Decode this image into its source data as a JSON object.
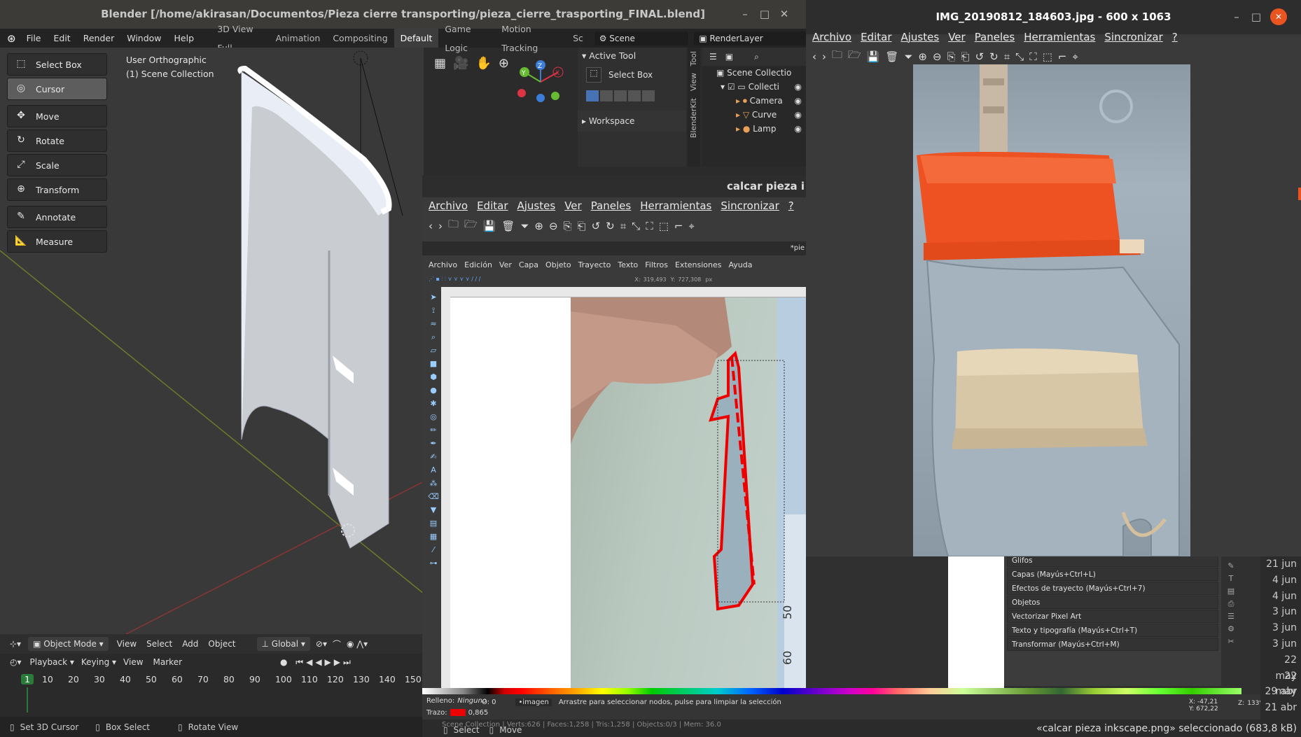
{
  "blender": {
    "title": "Blender [/home/akirasan/Documentos/Pieza cierre transporting/pieza_cierre_trasporting_FINAL.blend]",
    "menu": [
      "File",
      "Edit",
      "Render",
      "Window",
      "Help"
    ],
    "workspaces": [
      "3D View Full",
      "Animation",
      "Compositing",
      "Default",
      "Game Logic",
      "Motion Tracking",
      "Sc"
    ],
    "active_workspace": "Default",
    "scene": "Scene",
    "render_layer": "RenderLayer",
    "viewport_label": "User Orthographic",
    "collection_label": "(1) Scene Collection",
    "tools": [
      "Select Box",
      "Cursor",
      "Move",
      "Rotate",
      "Scale",
      "Transform",
      "Annotate",
      "Measure"
    ],
    "active_tool_header": "Active Tool",
    "active_tool_name": "Select Box",
    "workspace_header": "Workspace",
    "sidebar_tabs": [
      "Tool",
      "View",
      "BlenderKit"
    ],
    "outliner": {
      "root": "Scene Collectio",
      "collection": "Collecti",
      "items": [
        "Camera",
        "Curve",
        "Lamp"
      ]
    },
    "mode": "Object Mode",
    "header_menu": [
      "View",
      "Select",
      "Add",
      "Object"
    ],
    "orientation": "Global",
    "timeline_menu": [
      "Playback",
      "Keying",
      "View",
      "Marker"
    ],
    "frames": [
      "1",
      "10",
      "20",
      "30",
      "40",
      "50",
      "60",
      "70",
      "80",
      "90",
      "100",
      "110",
      "120",
      "130",
      "140",
      "150"
    ],
    "current_frame": "1",
    "status": [
      "Set 3D Cursor",
      "Box Select",
      "Rotate View",
      "Select",
      "Move"
    ],
    "scene_stats": "Scene Collection | Verts:626 | Faces:1,258 | Tris:1,258 | Objects:0/3 | Mem: 36.0"
  },
  "viewer1": {
    "title": "IMG_20190812_184603.jpg - 600 x 1063",
    "menu": [
      "Archivo",
      "Editar",
      "Ajustes",
      "Ver",
      "Paneles",
      "Herramientas",
      "Sincronizar",
      "?"
    ]
  },
  "viewer2": {
    "title": "calcar pieza i",
    "menu": [
      "Archivo",
      "Editar",
      "Ajustes",
      "Ver",
      "Paneles",
      "Herramientas",
      "Sincronizar",
      "?"
    ]
  },
  "inkscape": {
    "doc_title": "*pie",
    "menu": [
      "Archivo",
      "Edición",
      "Ver",
      "Capa",
      "Objeto",
      "Trayecto",
      "Texto",
      "Filtros",
      "Extensiones",
      "Ayuda"
    ],
    "x_label": "X:",
    "x_value": "319,493",
    "y_label": "Y:",
    "y_value": "727,308",
    "unit": "px",
    "fill_label": "Relleno:",
    "fill_value": "Ninguno",
    "stroke_label": "Trazo:",
    "stroke_width": "0,865",
    "opacity_label": "O:",
    "opacity_value": "0",
    "layer": "•imagen",
    "status_msg": "Arrastre para seleccionar nodos, pulse para limpiar la selección",
    "cursor_x": "X: -47,21",
    "cursor_y": "Y: 672,22",
    "zoom_label": "Z:",
    "zoom": "133%",
    "dialogs": [
      "Glifos",
      "Capas (Mayús+Ctrl+L)",
      "Efectos de trayecto (Mayús+Ctrl+7)",
      "Objetos",
      "Vectorizar Pixel Art",
      "Texto y tipografía (Mayús+Ctrl+T)",
      "Transformar (Mayús+Ctrl+M)"
    ],
    "ruler_marks": [
      "50",
      "60"
    ]
  },
  "file_dates": [
    "21 jun",
    "4 jun",
    "4 jun",
    "3 jun",
    "3 jun",
    "3 jun",
    "22 may",
    "22 may",
    "29 abr",
    "21 abr"
  ],
  "file_status": "«calcar pieza inkscape.png» seleccionado (683,8 kB)"
}
